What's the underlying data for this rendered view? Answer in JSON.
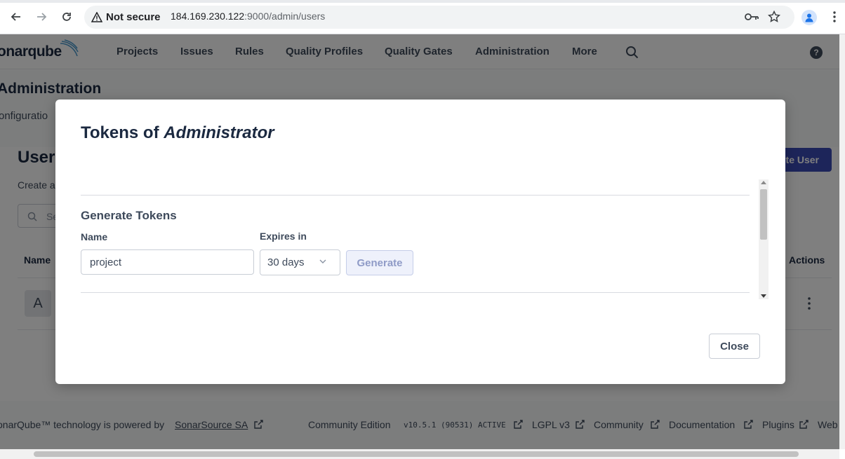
{
  "browser": {
    "security_label": "Not secure",
    "url_host": "184.169.230.122",
    "url_rest": ":9000/admin/users"
  },
  "nav": {
    "logo_text": "onarqube",
    "items": [
      "Projects",
      "Issues",
      "Rules",
      "Quality Profiles",
      "Quality Gates",
      "Administration",
      "More"
    ],
    "help_glyph": "?"
  },
  "admin": {
    "title": "Administration",
    "config_label": "onfiguratio"
  },
  "users": {
    "title": "User",
    "description": "Create a",
    "create_button": "te User",
    "search_placeholder": "Se",
    "col_name": "Name",
    "col_actions": "Actions",
    "avatar_letter": "A"
  },
  "modal": {
    "title_prefix": "Tokens of ",
    "title_user": "Administrator",
    "section_heading": "Generate Tokens",
    "name_label": "Name",
    "name_value": "project",
    "expires_label": "Expires in",
    "expires_value": "30 days",
    "generate_button": "Generate",
    "close_button": "Close"
  },
  "footer": {
    "powered_prefix": "onarQube™ technology is powered by ",
    "powered_link": "SonarSource SA",
    "edition": "Community Edition",
    "version": "v10.5.1 (90531) ACTIVE",
    "license": "LGPL v3",
    "community": "Community",
    "documentation": "Documentation",
    "plugins": "Plugins",
    "web": "Web"
  }
}
